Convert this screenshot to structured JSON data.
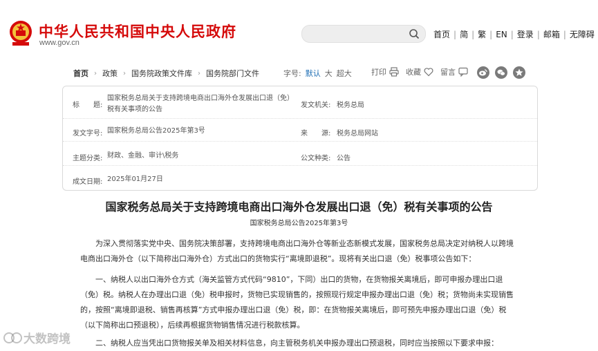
{
  "header": {
    "site_title": "中华人民共和国中央人民政府",
    "site_url": "www.gov.cn",
    "search_placeholder": "",
    "nav": [
      "首页",
      "简",
      "繁",
      "EN",
      "登录",
      "邮箱",
      "无障碍"
    ]
  },
  "breadcrumb": [
    "首页",
    "政策",
    "国务院政策文件库",
    "国务院部门文件"
  ],
  "font_size": {
    "label": "字号:",
    "options": [
      "默认",
      "大",
      "超大"
    ],
    "selected": "默认"
  },
  "tools": {
    "print": "打印",
    "favorite": "收藏",
    "comment": "留言"
  },
  "info": {
    "title_label": "标　　题:",
    "title_value_1": "国家税务总局关于支持跨境电商出口海外仓发展出口退（免）",
    "title_value_2": "税有关事项的公告",
    "issuer_label": "发文机关:",
    "issuer_value": "税务总局",
    "docno_label": "发文字号:",
    "docno_value": "国家税务总局公告2025年第3号",
    "source_label": "来　　源:",
    "source_value": "税务总局网站",
    "topic_label": "主题分类:",
    "topic_value": "财政、金融、审计\\税务",
    "type_label": "公文种类:",
    "type_value": "公告",
    "date_label": "成文日期:",
    "date_value": "2025年01月27日"
  },
  "article": {
    "title": "国家税务总局关于支持跨境电商出口海外仓发展出口退（免）税有关事项的公告",
    "doc_no": "国家税务总局公告2025年第3号",
    "para1": "为深入贯彻落实党中央、国务院决策部署，支持跨境电商出口海外仓等新业态新模式发展，国家税务总局决定对纳税人以跨境电商出口海外仓（以下简称出口海外仓）方式出口的货物实行“离境即退税”。现将有关出口退（免）税事项公告如下：",
    "para2": "一、纳税人以出口海外仓方式（海关监管方式代码“9810”，下同）出口的货物，在货物报关离境后，即可申报办理出口退（免）税。纳税人在办理出口退（免）税申报时，货物已实现销售的，按照现行规定申报办理出口退（免）税；货物尚未实现销售的，按照“离境即退税、销售再核算”方式申报办理出口退（免）税，即：在货物报关离境后，即可预先申报办理出口退（免）税（以下简称出口预退税），后续再根据货物销售情况进行税款核算。",
    "para3": "二、纳税人应当凭出口货物报关单及相关材料信息，向主管税务机关申报办理出口预退税，同时应当按照以下要求申报："
  },
  "watermark": "大数跨境",
  "colors": {
    "brand_red": "#d50a0a",
    "link_blue": "#1f6fb5"
  }
}
